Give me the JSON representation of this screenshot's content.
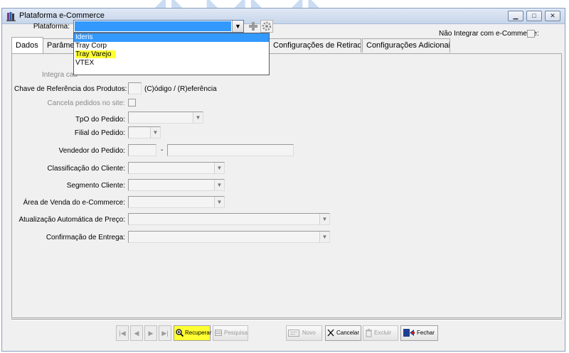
{
  "window": {
    "title": "Plataforma e-Commerce"
  },
  "header": {
    "plataforma_label": "Plataforma:",
    "nao_integrar_label": "Não Integrar com e-Commerce:"
  },
  "dropdown": {
    "options": [
      "Ideris",
      "Tray Corp",
      "Tray Varejo",
      "VTEX"
    ],
    "highlight_color": "#ffff33",
    "selection_color": "#3399ff"
  },
  "tabs": {
    "dados": "Dados",
    "parametros": "Parâme",
    "config_retirada": "Configurações de Retirada",
    "config_adicionais": "Configurações Adicionais"
  },
  "form": {
    "integra_label": "Integra cad",
    "chave_label": "Chave de Referência dos Produtos:",
    "chave_hint": "(C)ódigo / (R)eferência",
    "cancela_label": "Cancela pedidos no site:",
    "tpo_label": "TpO do Pedido:",
    "filial_label": "Filial do Pedido:",
    "vendedor_label": "Vendedor do Pedido:",
    "vendedor_sep": "-",
    "classificacao_label": "Classificação do Cliente:",
    "segmento_label": "Segmento Cliente:",
    "area_label": "Área de Venda do e-Commerce:",
    "atualizacao_label": "Atualização Automática de Preço:",
    "confirmacao_label": "Confirmação de Entrega:"
  },
  "toolbar": {
    "recuperar": "Recuperar",
    "pesquisa": "Pesquisa",
    "novo": "Novo",
    "cancelar": "Cancelar",
    "excluir": "Excluir",
    "fechar": "Fechar"
  }
}
